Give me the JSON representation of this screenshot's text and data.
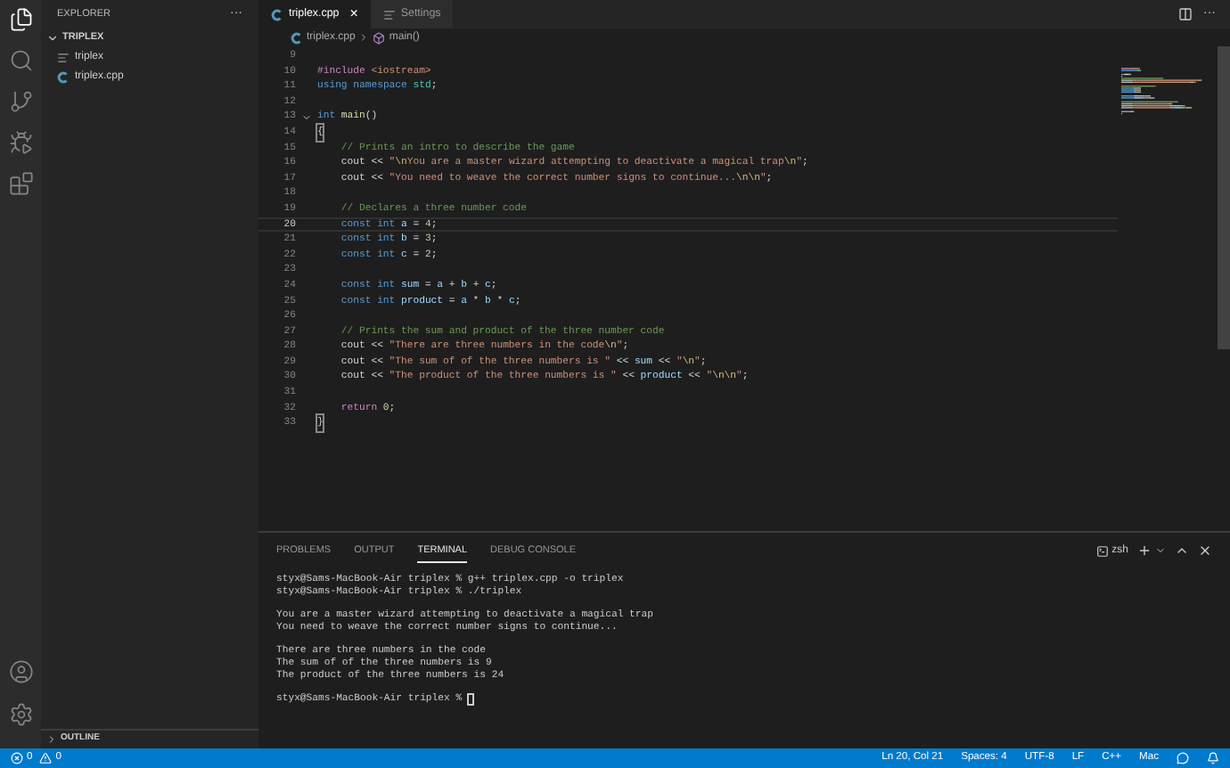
{
  "activity_bar": {
    "top": [
      {
        "kind": "files",
        "selected": true
      },
      {
        "kind": "search",
        "selected": false
      },
      {
        "kind": "source-control",
        "selected": false
      },
      {
        "kind": "run",
        "selected": false
      },
      {
        "kind": "extensions",
        "selected": false
      }
    ],
    "bottom": [
      {
        "kind": "account"
      },
      {
        "kind": "settings"
      }
    ]
  },
  "sidebar": {
    "title": "EXPLORER",
    "more": "···",
    "folder": {
      "name": "TRIPLEX",
      "expanded": true,
      "children": [
        {
          "name": "triplex",
          "kind": "binary"
        },
        {
          "name": "triplex.cpp",
          "kind": "cpp"
        }
      ]
    },
    "outline": {
      "name": "OUTLINE",
      "expanded": false
    }
  },
  "tabs": [
    {
      "label": "triplex.cpp",
      "kind": "cpp",
      "selected": true,
      "close": "×"
    },
    {
      "label": "Settings",
      "kind": "settings",
      "selected": false
    }
  ],
  "editor_actions": {
    "more": "···"
  },
  "breadcrumb": [
    {
      "label": "triplex.cpp",
      "kind": "cpp"
    },
    {
      "label": "main()",
      "kind": "function"
    }
  ],
  "editor": {
    "lines": [
      {
        "number": "9",
        "current": false
      },
      {
        "number": "10",
        "current": false,
        "tokens": [
          {
            "kind": "ctrl",
            "text": "#include"
          },
          {
            "kind": "str",
            "text": " <iostream>"
          }
        ]
      },
      {
        "number": "11",
        "current": false,
        "tokens": [
          {
            "kind": "kw",
            "text": "using"
          },
          {
            "kind": "kw",
            "text": " namespace"
          },
          {
            "kind": "type",
            "text": " std"
          },
          {
            "kind": "plain",
            "text": ";"
          }
        ]
      },
      {
        "number": "12",
        "current": false
      },
      {
        "number": "13",
        "current": false,
        "fold_expanded": true,
        "tokens": [
          {
            "kind": "kw",
            "text": "int"
          },
          {
            "kind": "fn",
            "text": " main"
          },
          {
            "kind": "plain",
            "text": "()"
          }
        ]
      },
      {
        "number": "14",
        "current": false,
        "matched": true,
        "tokens": [
          {
            "kind": "plain",
            "text": "{"
          }
        ]
      },
      {
        "number": "15",
        "current": false,
        "tokens": [
          {
            "kind": "com",
            "text": "    // Prints an intro to describe the game"
          }
        ]
      },
      {
        "number": "16",
        "current": false,
        "tokens": [
          {
            "kind": "plain",
            "text": "    cout << "
          },
          {
            "kind": "str",
            "text": "\""
          },
          {
            "kind": "esc",
            "text": "\\n"
          },
          {
            "kind": "str",
            "text": "You are a master wizard attempting to deactivate a magical trap"
          },
          {
            "kind": "esc",
            "text": "\\n"
          },
          {
            "kind": "str",
            "text": "\""
          },
          {
            "kind": "plain",
            "text": ";"
          }
        ]
      },
      {
        "number": "17",
        "current": false,
        "tokens": [
          {
            "kind": "plain",
            "text": "    cout << "
          },
          {
            "kind": "str",
            "text": "\"You need to weave the correct number signs to continue..."
          },
          {
            "kind": "esc",
            "text": "\\n\\n"
          },
          {
            "kind": "str",
            "text": "\""
          },
          {
            "kind": "plain",
            "text": ";"
          }
        ]
      },
      {
        "number": "18",
        "current": false
      },
      {
        "number": "19",
        "current": false,
        "tokens": [
          {
            "kind": "com",
            "text": "    // Declares a three number code"
          }
        ]
      },
      {
        "number": "20",
        "current": true,
        "tokens": [
          {
            "kind": "kw",
            "text": "    const"
          },
          {
            "kind": "kw",
            "text": " int"
          },
          {
            "kind": "var",
            "text": " a"
          },
          {
            "kind": "plain",
            "text": " = "
          },
          {
            "kind": "num",
            "text": "4"
          },
          {
            "kind": "plain",
            "text": ";"
          }
        ]
      },
      {
        "number": "21",
        "current": false,
        "tokens": [
          {
            "kind": "kw",
            "text": "    const"
          },
          {
            "kind": "kw",
            "text": " int"
          },
          {
            "kind": "var",
            "text": " b"
          },
          {
            "kind": "plain",
            "text": " = "
          },
          {
            "kind": "num",
            "text": "3"
          },
          {
            "kind": "plain",
            "text": ";"
          }
        ]
      },
      {
        "number": "22",
        "current": false,
        "tokens": [
          {
            "kind": "kw",
            "text": "    const"
          },
          {
            "kind": "kw",
            "text": " int"
          },
          {
            "kind": "var",
            "text": " c"
          },
          {
            "kind": "plain",
            "text": " = "
          },
          {
            "kind": "num",
            "text": "2"
          },
          {
            "kind": "plain",
            "text": ";"
          }
        ]
      },
      {
        "number": "23",
        "current": false
      },
      {
        "number": "24",
        "current": false,
        "tokens": [
          {
            "kind": "kw",
            "text": "    const"
          },
          {
            "kind": "kw",
            "text": " int"
          },
          {
            "kind": "var",
            "text": " sum"
          },
          {
            "kind": "plain",
            "text": " = "
          },
          {
            "kind": "var",
            "text": "a"
          },
          {
            "kind": "plain",
            "text": " + "
          },
          {
            "kind": "var",
            "text": "b"
          },
          {
            "kind": "plain",
            "text": " + "
          },
          {
            "kind": "var",
            "text": "c"
          },
          {
            "kind": "plain",
            "text": ";"
          }
        ]
      },
      {
        "number": "25",
        "current": false,
        "tokens": [
          {
            "kind": "kw",
            "text": "    const"
          },
          {
            "kind": "kw",
            "text": " int"
          },
          {
            "kind": "var",
            "text": " product"
          },
          {
            "kind": "plain",
            "text": " = "
          },
          {
            "kind": "var",
            "text": "a"
          },
          {
            "kind": "plain",
            "text": " * "
          },
          {
            "kind": "var",
            "text": "b"
          },
          {
            "kind": "plain",
            "text": " * "
          },
          {
            "kind": "var",
            "text": "c"
          },
          {
            "kind": "plain",
            "text": ";"
          }
        ]
      },
      {
        "number": "26",
        "current": false
      },
      {
        "number": "27",
        "current": false,
        "tokens": [
          {
            "kind": "com",
            "text": "    // Prints the sum and product of the three number code"
          }
        ]
      },
      {
        "number": "28",
        "current": false,
        "tokens": [
          {
            "kind": "plain",
            "text": "    cout << "
          },
          {
            "kind": "str",
            "text": "\"There are three numbers in the code"
          },
          {
            "kind": "esc",
            "text": "\\n"
          },
          {
            "kind": "str",
            "text": "\""
          },
          {
            "kind": "plain",
            "text": ";"
          }
        ]
      },
      {
        "number": "29",
        "current": false,
        "tokens": [
          {
            "kind": "plain",
            "text": "    cout << "
          },
          {
            "kind": "str",
            "text": "\"The sum of of the three numbers is \""
          },
          {
            "kind": "plain",
            "text": " << "
          },
          {
            "kind": "var",
            "text": "sum"
          },
          {
            "kind": "plain",
            "text": " << "
          },
          {
            "kind": "str",
            "text": "\""
          },
          {
            "kind": "esc",
            "text": "\\n"
          },
          {
            "kind": "str",
            "text": "\""
          },
          {
            "kind": "plain",
            "text": ";"
          }
        ]
      },
      {
        "number": "30",
        "current": false,
        "tokens": [
          {
            "kind": "plain",
            "text": "    cout << "
          },
          {
            "kind": "str",
            "text": "\"The product of the three numbers is \""
          },
          {
            "kind": "plain",
            "text": " << "
          },
          {
            "kind": "var",
            "text": "product"
          },
          {
            "kind": "plain",
            "text": " << "
          },
          {
            "kind": "str",
            "text": "\""
          },
          {
            "kind": "esc",
            "text": "\\n\\n"
          },
          {
            "kind": "str",
            "text": "\""
          },
          {
            "kind": "plain",
            "text": ";"
          }
        ]
      },
      {
        "number": "31",
        "current": false
      },
      {
        "number": "32",
        "current": false,
        "tokens": [
          {
            "kind": "ctrl",
            "text": "    return"
          },
          {
            "kind": "num",
            "text": " 0"
          },
          {
            "kind": "plain",
            "text": ";"
          }
        ]
      },
      {
        "number": "33",
        "current": false,
        "matched": true,
        "tokens": [
          {
            "kind": "plain",
            "text": "}"
          }
        ]
      }
    ]
  },
  "panel": {
    "tabs": [
      {
        "label": "PROBLEMS",
        "selected": false
      },
      {
        "label": "OUTPUT",
        "selected": false
      },
      {
        "label": "TERMINAL",
        "selected": true
      },
      {
        "label": "DEBUG CONSOLE",
        "selected": false
      }
    ],
    "shell": "zsh",
    "terminal": [
      [
        "styx@Sams-MacBook-Air triplex % g++ triplex.cpp -o triplex",
        "styx@Sams-MacBook-Air triplex % ./triplex"
      ],
      [
        "You are a master wizard attempting to deactivate a magical trap",
        "You need to weave the correct number signs to continue..."
      ],
      [
        "There are three numbers in the code",
        "The sum of of the three numbers is 9",
        "The product of the three numbers is 24"
      ]
    ],
    "prompt": "styx@Sams-MacBook-Air triplex %",
    "cursor": true
  },
  "status_bar": {
    "left": [
      {
        "kind": "errors",
        "text": "0"
      },
      {
        "kind": "warnings",
        "text": "0"
      }
    ],
    "right": [
      "Ln 20, Col 21",
      "Spaces: 4",
      "UTF-8",
      "LF",
      "C++",
      "Mac"
    ],
    "icons": [
      {
        "kind": "feedback"
      },
      {
        "kind": "bell"
      }
    ]
  }
}
